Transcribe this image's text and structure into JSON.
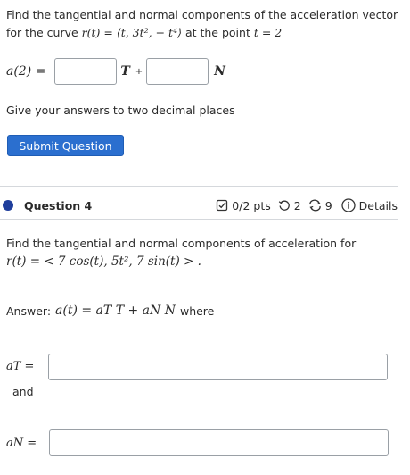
{
  "question3": {
    "prompt_prefix": "Find the tangential and normal components of the acceleration vector for the curve",
    "curve_expr": "r(t) = ⟨t, 3t², − t⁴⟩",
    "prompt_mid": "at the point",
    "point_expr": "t = 2",
    "lhs": "a(2) =",
    "T_symbol": "T",
    "plus": "+",
    "N_symbol": "N",
    "answer_T": "",
    "answer_N": "",
    "note": "Give your answers to two decimal places",
    "submit_label": "Submit Question"
  },
  "question4": {
    "title": "Question 4",
    "pts": "0/2 pts",
    "retries": "2",
    "attempts": "9",
    "details": "Details",
    "prompt": "Find the tangential and normal components of acceleration for",
    "curve_expr": "r(t) = < 7 cos(t), 5t², 7 sin(t) > .",
    "answer_prefix": "Answer:",
    "answer_expr": "a(t) = aT T + aN N",
    "answer_suffix": "where",
    "aT_label": "aT =",
    "and_label": "and",
    "aN_label": "aN =",
    "aT_value": "",
    "aN_value": ""
  },
  "colors": {
    "submit_bg": "#2b6fcf",
    "question_dot": "#1f3e9c",
    "divider": "#d5d8dc"
  },
  "icons": [
    "checkbox-check-icon",
    "retry-icon",
    "refresh-icon",
    "info-icon"
  ]
}
